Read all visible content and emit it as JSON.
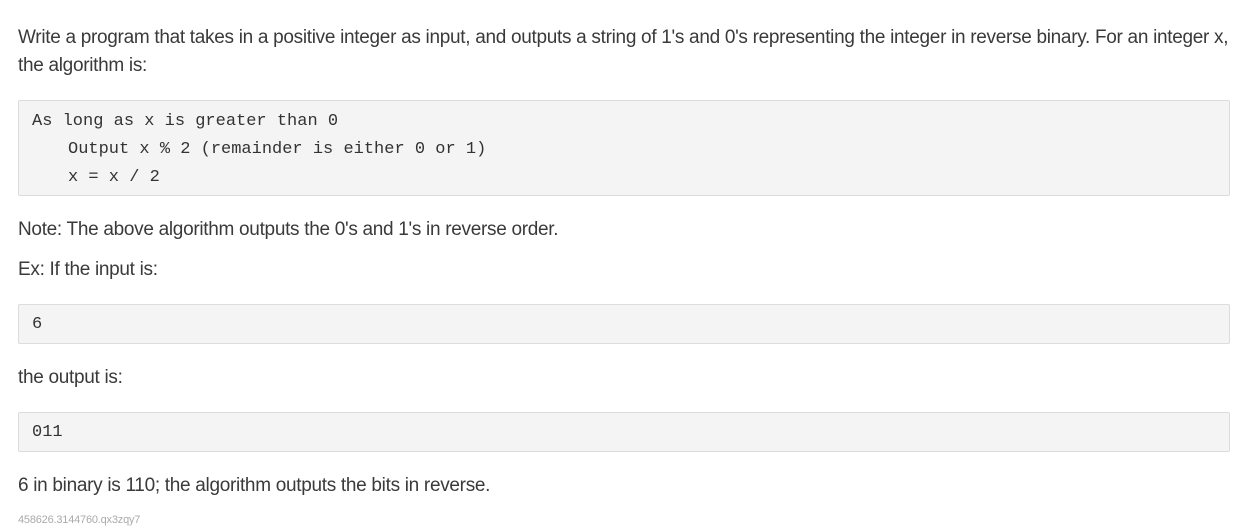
{
  "intro": "Write a program that takes in a positive integer as input, and outputs a string of 1's and 0's representing the integer in reverse binary. For an integer x, the algorithm is:",
  "algorithm": {
    "lines": [
      "As long as x is greater than 0",
      "Output x % 2 (remainder is either 0 or 1)",
      "x = x / 2"
    ]
  },
  "note": "Note: The above algorithm outputs the 0's and 1's in reverse order.",
  "example_intro": "Ex: If the input is:",
  "example_input": "6",
  "output_intro": "the output is:",
  "example_output": "011",
  "explanation": "6 in binary is 110; the algorithm outputs the bits in reverse.",
  "footer_id": "458626.3144760.qx3zqy7"
}
